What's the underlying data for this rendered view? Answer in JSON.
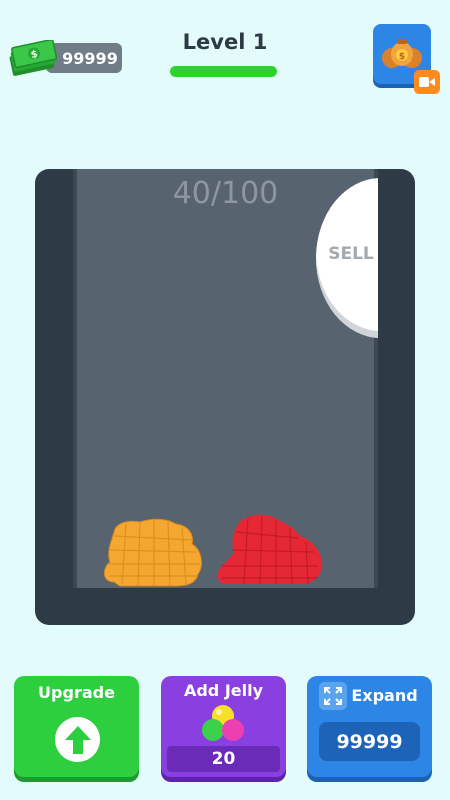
{
  "header": {
    "currency_amount": "99999",
    "currency_icon": "cash-stack-icon",
    "level_title": "Level 1",
    "level_progress": 1.0,
    "shop_icon": "money-bags-icon",
    "video_badge_icon": "video-ad-icon"
  },
  "container": {
    "capacity_text": "40/100",
    "sell_label": "SELL",
    "jellies": [
      {
        "color": "orange",
        "hex": "#f4a832"
      },
      {
        "color": "red",
        "hex": "#e62834"
      }
    ]
  },
  "buttons": {
    "upgrade": {
      "label": "Upgrade",
      "icon": "arrow-up-icon"
    },
    "add_jelly": {
      "label": "Add Jelly",
      "price": "20",
      "icon": "jelly-cubes-icon"
    },
    "expand": {
      "label": "Expand",
      "price": "99999",
      "icon": "expand-arrows-icon"
    }
  },
  "colors": {
    "background": "#e3fbfa",
    "upgrade_green": "#2dcf3f",
    "add_jelly_purple": "#8a3fe0",
    "expand_blue": "#2d86e6",
    "level_bar_green": "#2fd12f"
  }
}
